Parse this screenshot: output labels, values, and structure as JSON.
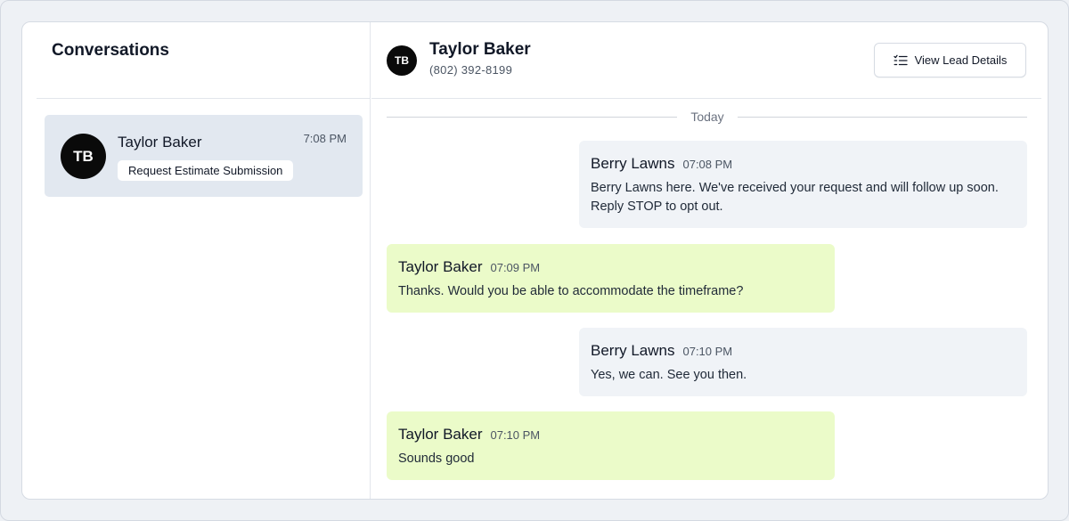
{
  "sidebar": {
    "title": "Conversations",
    "conversations": [
      {
        "initials": "TB",
        "name": "Taylor Baker",
        "time": "7:08 PM",
        "tag": "Request Estimate Submission"
      }
    ]
  },
  "contact": {
    "initials": "TB",
    "name": "Taylor Baker",
    "phone": "(802) 392-8199"
  },
  "header": {
    "lead_button_label": "View Lead Details",
    "lead_button_icon": "list-icon"
  },
  "thread": {
    "date_divider": "Today",
    "messages": [
      {
        "direction": "outgoing",
        "sender": "Berry Lawns",
        "time": "07:08 PM",
        "text": "Berry Lawns here. We've received your request and will follow up soon. Reply STOP to opt out."
      },
      {
        "direction": "incoming",
        "sender": "Taylor Baker",
        "time": "07:09 PM",
        "text": "Thanks. Would you be able to accommodate the timeframe?"
      },
      {
        "direction": "outgoing",
        "sender": "Berry Lawns",
        "time": "07:10 PM",
        "text": "Yes, we can. See you then."
      },
      {
        "direction": "incoming",
        "sender": "Taylor Baker",
        "time": "07:10 PM",
        "text": "Sounds good"
      }
    ]
  },
  "colors": {
    "outgoing_bubble": "#f0f3f7",
    "incoming_bubble": "#ebfbc9",
    "selected_conversation": "#e2e8f0",
    "avatar": "#0a0a0a"
  }
}
